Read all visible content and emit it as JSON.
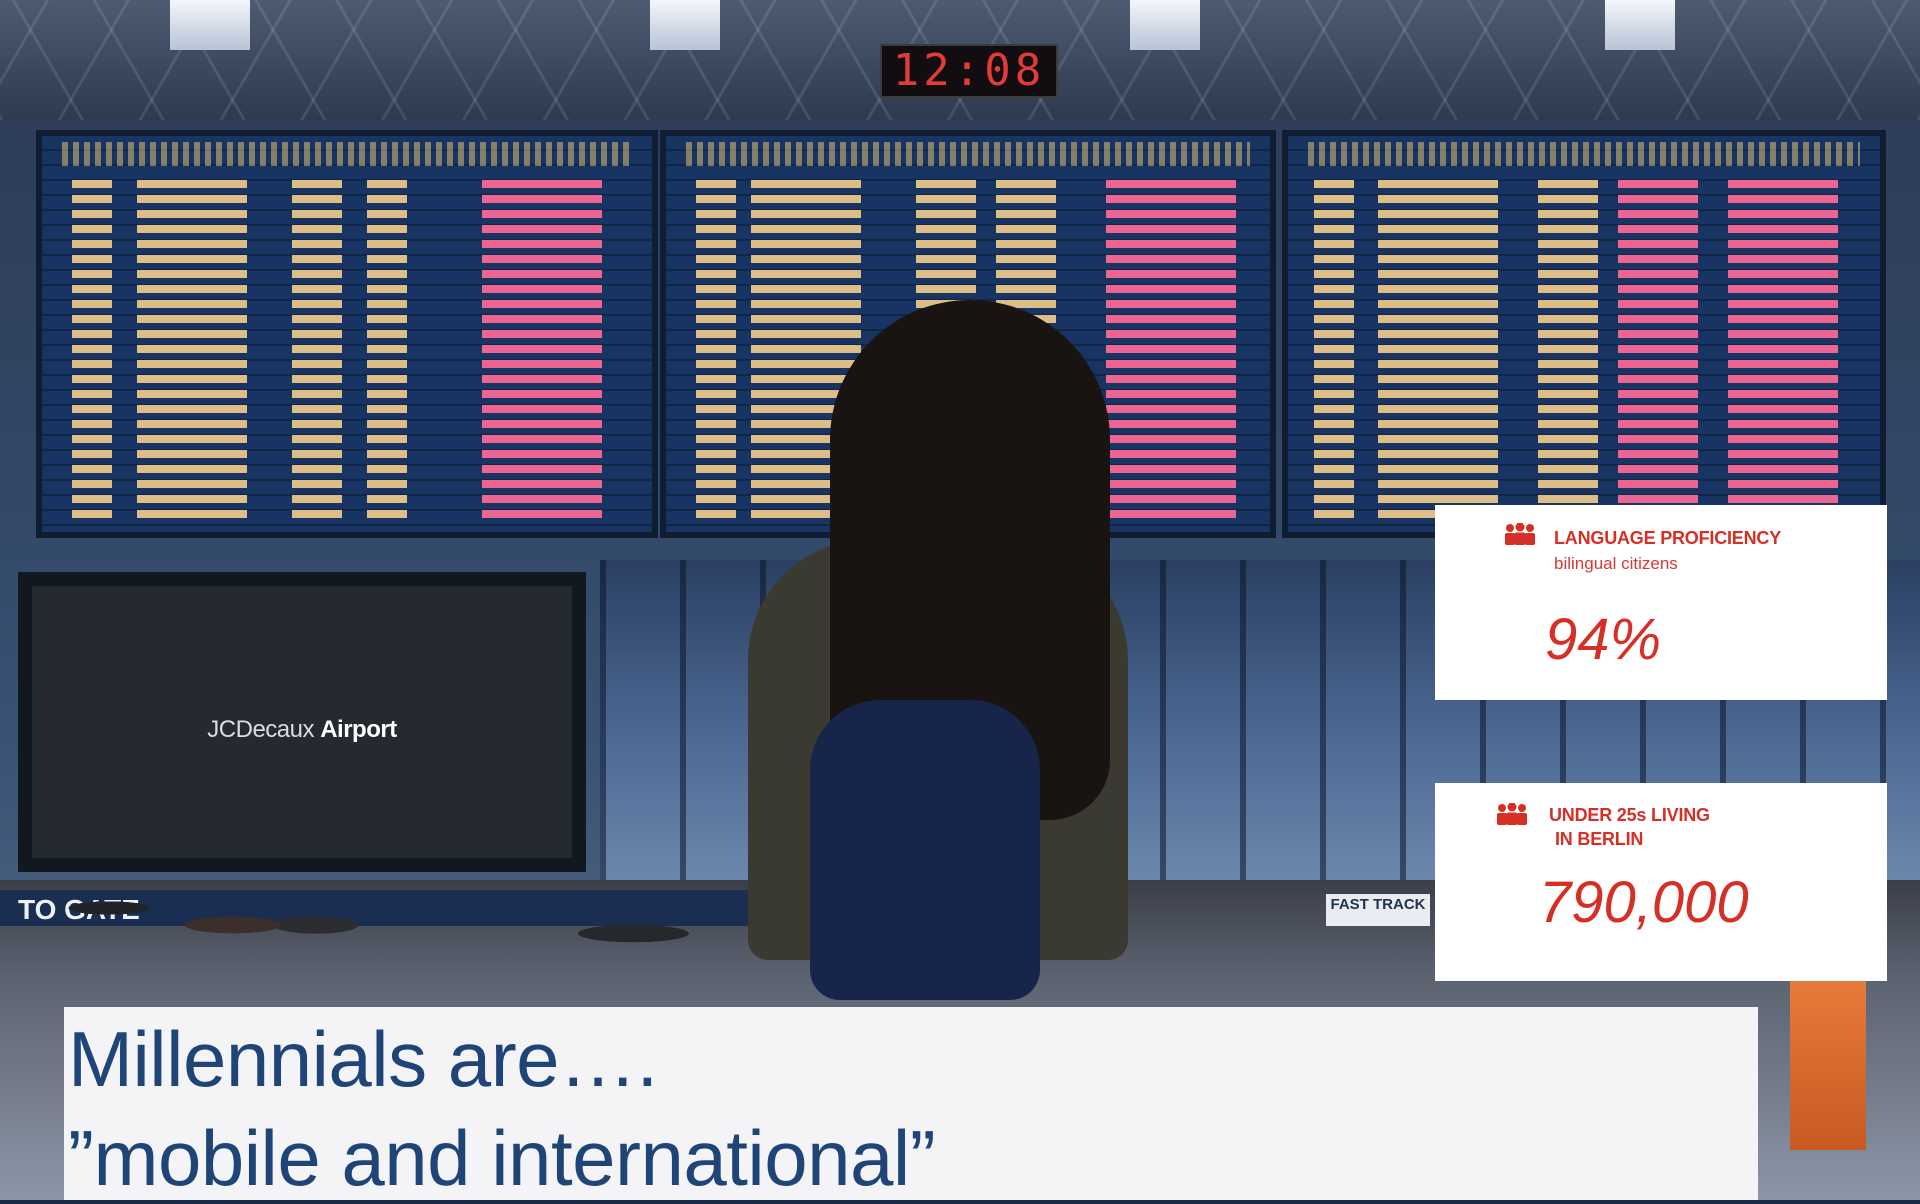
{
  "background": {
    "clock": "12:08",
    "screen_logo_light": "JCDecaux",
    "screen_logo_bold": "Airport",
    "gate_sign": "TO   GATE",
    "fast_track_sign": "FAST TRACK"
  },
  "stats": [
    {
      "icon": "people-icon",
      "label": "LANGUAGE PROFICIENCY",
      "sublabel": "bilingual citizens",
      "value": "94%"
    },
    {
      "icon": "people-icon",
      "label_line1": "UNDER 25s LIVING",
      "label_line2": "IN BERLIN",
      "value": "790,000"
    }
  ],
  "title": {
    "line1": "Millennials are….",
    "line2": "”mobile and international”"
  },
  "colors": {
    "accent_red": "#d62f26",
    "title_blue": "#1f4477",
    "title_band": "#f4f4f6"
  }
}
